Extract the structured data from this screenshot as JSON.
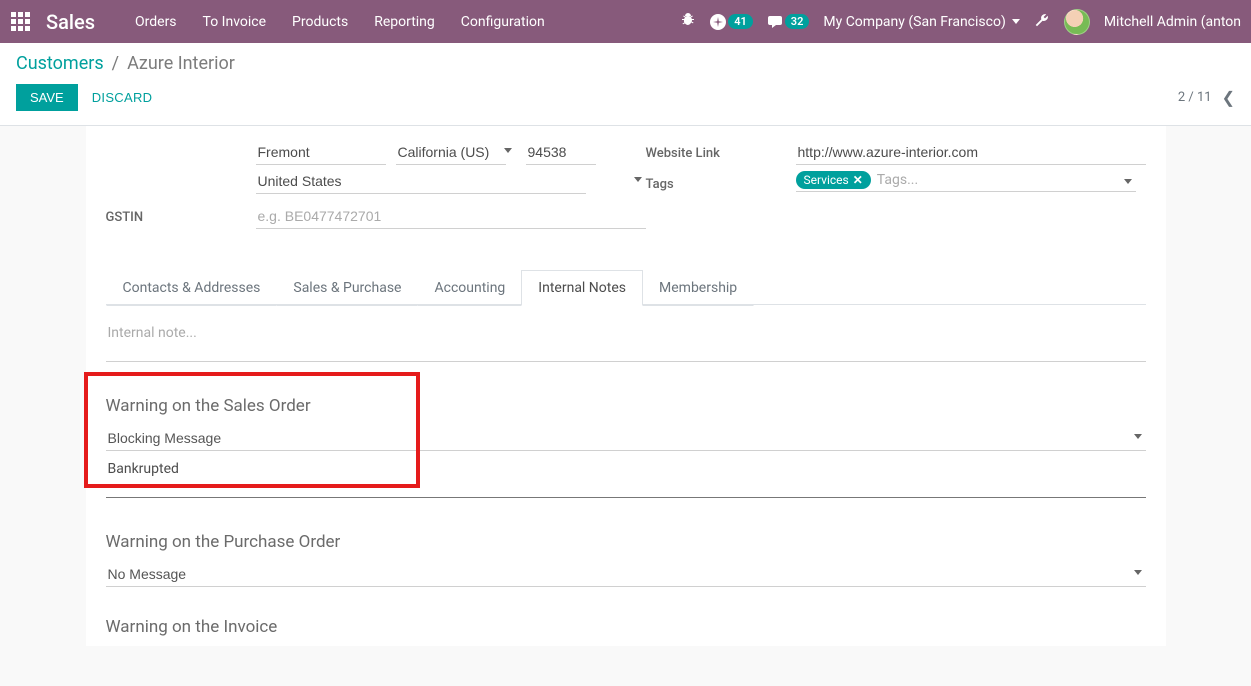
{
  "topbar": {
    "brand": "Sales",
    "menu": [
      "Orders",
      "To Invoice",
      "Products",
      "Reporting",
      "Configuration"
    ],
    "activity_count": "41",
    "discuss_count": "32",
    "company": "My Company (San Francisco)",
    "user_name": "Mitchell Admin (anton"
  },
  "breadcrumb": {
    "root": "Customers",
    "sep": "/",
    "current": "Azure Interior"
  },
  "actions": {
    "save": "SAVE",
    "discard": "DISCARD"
  },
  "pager": {
    "pos": "2 / 11"
  },
  "address": {
    "city": "Fremont",
    "state": "California (US)",
    "zip": "94538",
    "country": "United States"
  },
  "gstin": {
    "label": "GSTIN",
    "placeholder": "e.g. BE0477472701",
    "value": ""
  },
  "website": {
    "label": "Website Link",
    "value": "http://www.azure-interior.com"
  },
  "tags": {
    "label": "Tags",
    "chip": "Services",
    "placeholder": "Tags..."
  },
  "tabs": {
    "items": [
      "Contacts & Addresses",
      "Sales & Purchase",
      "Accounting",
      "Internal Notes",
      "Membership"
    ],
    "active_index": 3
  },
  "internal_notes": {
    "note_placeholder": "Internal note...",
    "note_value": "",
    "sales_warning_title": "Warning on the Sales Order",
    "sales_warning_type": "Blocking Message",
    "sales_warning_msg": "Bankrupted",
    "purchase_warning_title": "Warning on the Purchase Order",
    "purchase_warning_type": "No Message",
    "invoice_warning_title": "Warning on the Invoice"
  }
}
